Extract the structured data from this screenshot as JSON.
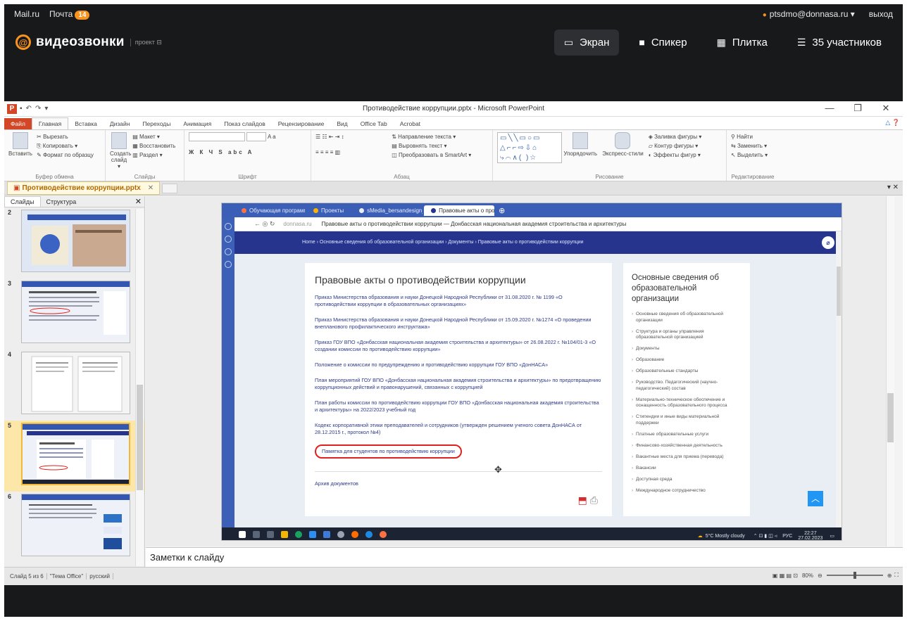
{
  "vc": {
    "mail_link": "Mail.ru",
    "pochta_link": "Почта",
    "pochta_badge": "14",
    "user": "ptsdmo@donnasa.ru ▾",
    "logout": "выход",
    "logo_symbol": "@",
    "logo_text": "видеозвонки",
    "logo_sub": "проект ⊟",
    "modes": [
      {
        "label": "Экран",
        "icon": "screen-icon"
      },
      {
        "label": "Спикер",
        "icon": "speaker-icon"
      },
      {
        "label": "Плитка",
        "icon": "tile-icon"
      },
      {
        "label": "35 участников",
        "icon": "list-icon"
      }
    ]
  },
  "ppt": {
    "window_title": "Противодействие коррупции.pptx - Microsoft PowerPoint",
    "ribbon_tabs": [
      "Файл",
      "Главная",
      "Вставка",
      "Дизайн",
      "Переходы",
      "Анимация",
      "Показ слайдов",
      "Рецензирование",
      "Вид",
      "Office Tab",
      "Acrobat"
    ],
    "groups": {
      "clipboard": {
        "name": "Буфер обмена",
        "paste": "Вставить",
        "cut": "Вырезать",
        "copy": "Копировать ▾",
        "format": "Формат по образцу"
      },
      "slides": {
        "name": "Слайды",
        "create": "Создать слайд ▾",
        "layout": "Макет ▾",
        "reset": "Восстановить",
        "section": "Раздел ▾"
      },
      "font": {
        "name": "Шрифт"
      },
      "paragraph": {
        "name": "Абзац",
        "direction": "Направление текста ▾",
        "align": "Выровнять текст ▾",
        "smartart": "Преобразовать в SmartArt ▾"
      },
      "drawing": {
        "name": "Рисование",
        "arrange": "Упорядочить",
        "styles": "Экспресс-стили",
        "fill": "Заливка фигуры ▾",
        "outline": "Контур фигуры ▾",
        "effects": "Эффекты фигур ▾"
      },
      "editing": {
        "name": "Редактирование",
        "find": "Найти",
        "replace": "Заменить ▾",
        "select": "Выделить ▾"
      }
    },
    "doc_tab": "Противодействие коррупции.pptx",
    "panel_tabs": [
      "Слайды",
      "Структура"
    ],
    "slide_numbers": [
      "2",
      "3",
      "4",
      "5",
      "6"
    ],
    "notes_placeholder": "Заметки к слайду",
    "status": {
      "slide": "Слайд 5 из 6",
      "theme": "\"Тема Office\"",
      "lang": "русский",
      "zoom": "80%",
      "zoom_level": 0.5
    }
  },
  "slide": {
    "browser_tabs": [
      "Обучающая программа",
      "Проекты",
      "sMedia_bersandesign_asst",
      "Правовые акты о проти..."
    ],
    "address_host": "donnasa.ru",
    "address_title": "Правовые акты о противодействии коррупции — Донбасская национальная академия строительства и архитектуры",
    "breadcrumb": "Home  ›  Основные сведения об образовательной организации  ›  Документы  ›  Правовые акты о противодействии коррупции",
    "heading": "Правовые акты о противодействии коррупции",
    "links": [
      "Приказ Министерства образования и науки Донецкой Народной Республики от 31.08.2020 г. № 1199 «О противодействии коррупции в образовательных организациях»",
      "Приказ Министерства образования и науки Донецкой Народной Республики от 15.09.2020 г. №1274 «О проведении внепланового профилактического инструктажа»",
      "Приказ ГОУ ВПО «Донбасская национальная академия строительства и архитектуры» от 26.08.2022 г. №104/01-3 «О создании комиссии по противодействию коррупции»",
      "Положение о комиссии по предупреждению и противодействию коррупции ГОУ ВПО «ДонНАСА»",
      "План мероприятий ГОУ ВПО «Донбасская национальная академия строительства и архитектуры» по предотвращению коррупционных действий и правонарушений, связанных с коррупцией",
      "План работы комиссии по противодействию коррупции ГОУ ВПО «Донбасская национальная академия строительства и архитектуры» на 2022/2023 учебный год",
      "Кодекс корпоративной этики преподавателей и сотрудников (утвержден решением ученого совета ДонНАСА от 28.12.2015 г., протокол №4)"
    ],
    "circled_link": "Памятка для студентов по противодействию коррупции",
    "archive": "Архив документов",
    "sidebar_title": "Основные сведения об образовательной организации",
    "sidebar_items": [
      "Основные сведения об образовательной организации",
      "Структура и органы управления образовательной организацией",
      "Документы",
      "Образование",
      "Образовательные стандарты",
      "Руководство. Педагогический (научно-педагогический) состав",
      "Материально-техническое обеспечение и оснащенность образовательного процесса",
      "Стипендии и иные виды материальной поддержки",
      "Платные образовательные услуги",
      "Финансово-хозяйственная деятельность",
      "Вакантные места для приема (перевода)",
      "Вакансии",
      "Доступная среда",
      "Международное сотрудничество"
    ],
    "weather": "5°C Mostly cloudy",
    "lang": "РУС",
    "time": "22:27",
    "date": "27.02.2023"
  }
}
